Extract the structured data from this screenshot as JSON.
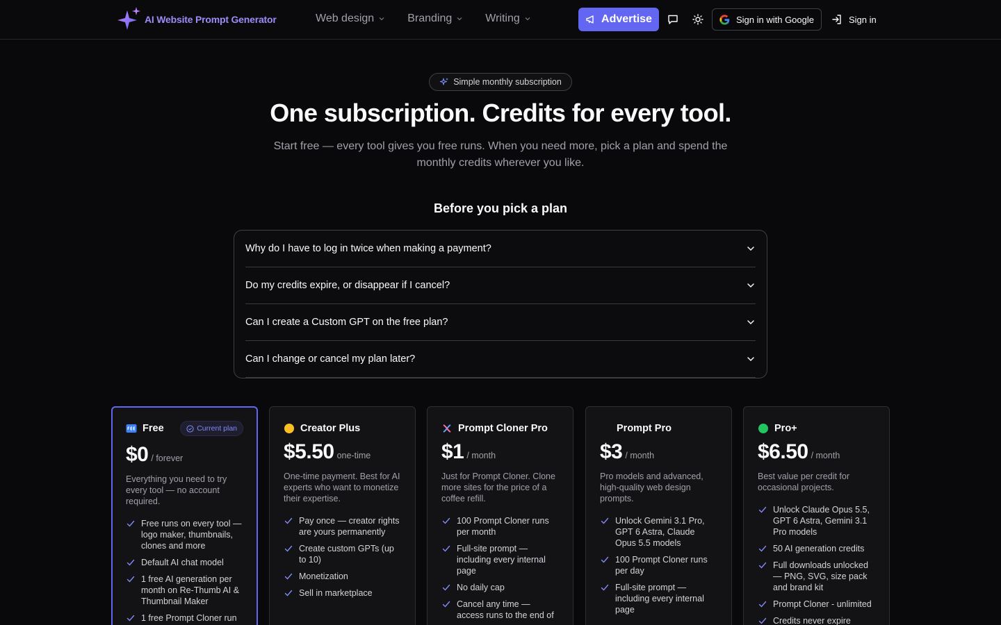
{
  "nav": {
    "logo_text": "AI Website Prompt Generator",
    "menu": [
      {
        "label": "Web design"
      },
      {
        "label": "Branding"
      },
      {
        "label": "Writing"
      }
    ],
    "advertise_label": "Advertise",
    "google_signin_label": "Sign in with Google",
    "signin_label": "Sign in"
  },
  "hero": {
    "pill": "Simple monthly subscription",
    "title": "One subscription. Credits for every tool.",
    "subtitle": "Start free — every tool gives you free runs. When you need more, pick a plan and spend the monthly credits wherever you like."
  },
  "faq": {
    "title": "Before you pick a plan",
    "items": [
      {
        "q": "Why do I have to log in twice when making a payment?"
      },
      {
        "q": "Do my credits expire, or disappear if I cancel?"
      },
      {
        "q": "Can I create a Custom GPT on the free plan?"
      },
      {
        "q": "Can I change or cancel my plan later?"
      }
    ]
  },
  "plans": [
    {
      "name": "Free",
      "badge": "Current plan",
      "price": "$0",
      "period": "/ forever",
      "desc": "Everything you need to try every tool — no account required.",
      "features": [
        "Free runs on every tool — logo maker, thumbnails, clones and more",
        "Default AI chat model",
        "1 free AI generation per month on Re-Thumb AI & Thumbnail Maker",
        "1 free Prompt Cloner run"
      ]
    },
    {
      "name": "Creator Plus",
      "price": "$5.50",
      "period": "one-time",
      "desc": "One-time payment. Best for AI experts who want to monetize their expertise.",
      "features": [
        "Pay once — creator rights are yours permanently",
        "Create custom GPTs (up to 10)",
        "Monetization",
        "Sell in marketplace"
      ]
    },
    {
      "name": "Prompt Cloner Pro",
      "price": "$1",
      "period": "/ month",
      "desc": "Just for Prompt Cloner. Clone more sites for the price of a coffee refill.",
      "features": [
        "100 Prompt Cloner runs per month",
        "Full-site prompt — including every internal page",
        "No daily cap",
        "Cancel any time — access runs to the end of"
      ]
    },
    {
      "name": "Prompt Pro",
      "price": "$3",
      "period": "/ month",
      "desc": "Pro models and advanced, high-quality web design prompts.",
      "features": [
        "Unlock Gemini 3.1 Pro, GPT 6 Astra, Claude Opus 5.5 models",
        "100 Prompt Cloner runs per day",
        "Full-site prompt — including every internal page"
      ]
    },
    {
      "name": "Pro+",
      "price": "$6.50",
      "period": "/ month",
      "desc": "Best value per credit for occasional projects.",
      "features": [
        "Unlock Claude Opus 5.5, GPT 6 Astra, Gemini 3.1 Pro models",
        "50 AI generation credits",
        "Full downloads unlocked — PNG, SVG, size pack and brand kit",
        "Prompt Cloner - unlimited",
        "Credits never expire"
      ]
    }
  ],
  "colors": {
    "accent": "#6366f1",
    "background": "#09090b",
    "card": "#131316"
  }
}
